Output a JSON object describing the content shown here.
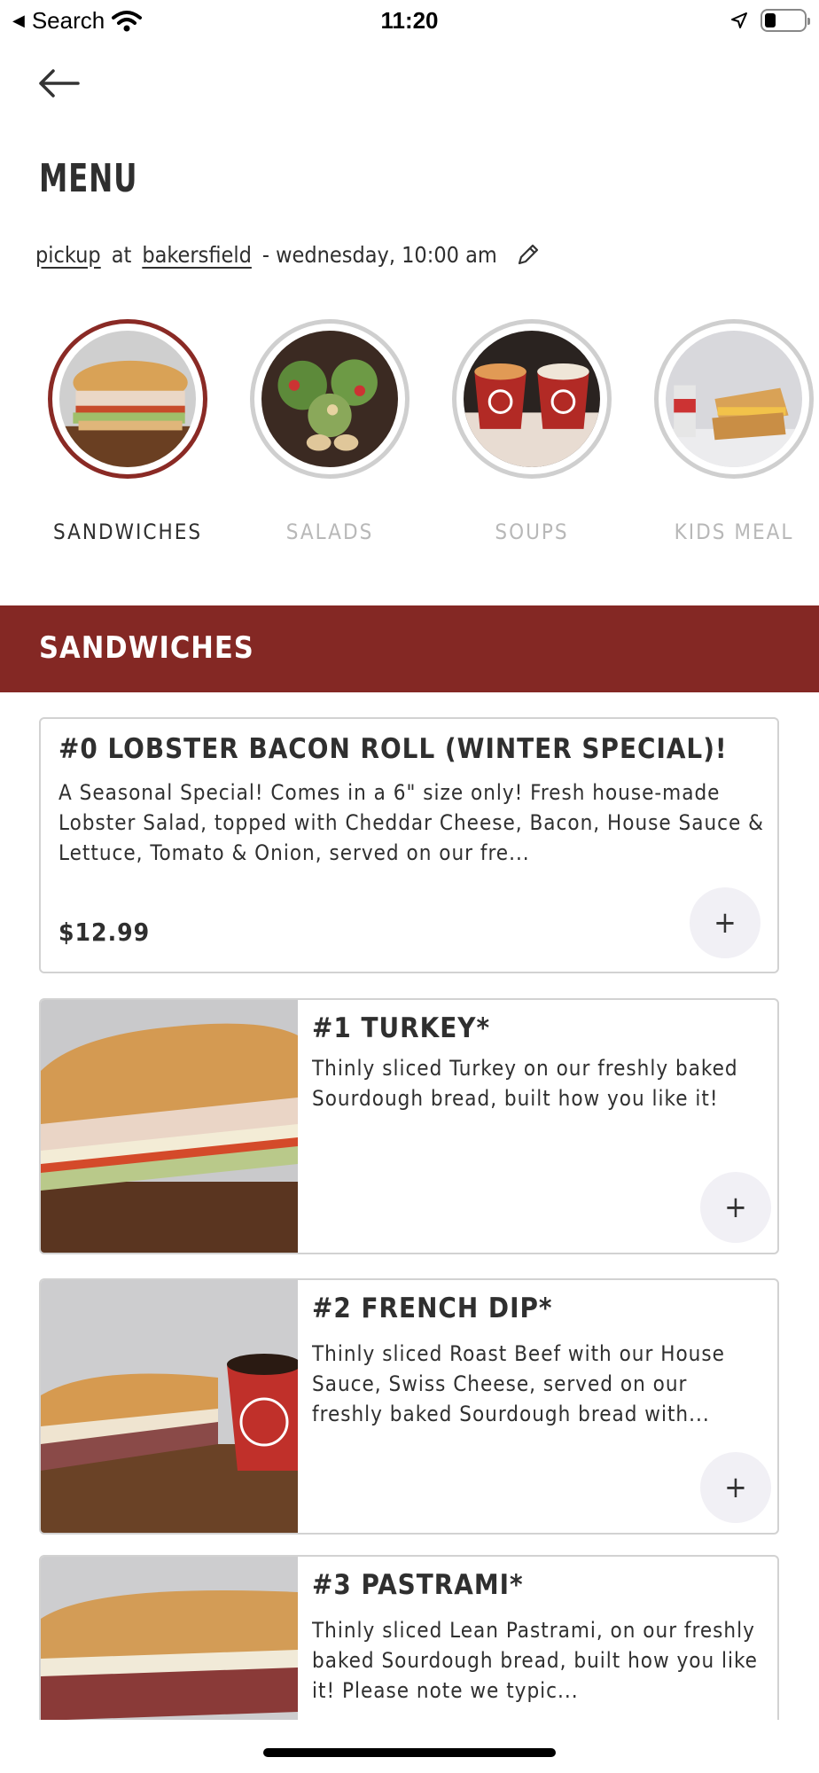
{
  "status_bar": {
    "back_app": "Search",
    "time": "11:20"
  },
  "header": {
    "title": "MENU"
  },
  "order_info": {
    "method": "pickup",
    "at": "at",
    "location": "bakersfield",
    "time": "- wednesday, 10:00 am"
  },
  "categories": [
    {
      "label": "SANDWICHES",
      "active": true
    },
    {
      "label": "SALADS",
      "active": false
    },
    {
      "label": "SOUPS",
      "active": false
    },
    {
      "label": "KIDS MEAL",
      "active": false
    }
  ],
  "section": {
    "title": "SANDWICHES"
  },
  "items": [
    {
      "name": "#0 LOBSTER BACON ROLL (WINTER SPECIAL)!",
      "description": "A Seasonal Special! Comes in a 6\" size only! Fresh house-made Lobster Salad, topped with Cheddar Cheese, Bacon, House Sauce & Lettuce, Tomato & Onion, served on our fre...",
      "price": "$12.99"
    },
    {
      "name": "#1 TURKEY*",
      "description": "Thinly sliced Turkey on our freshly baked Sourdough bread, built how you like it!"
    },
    {
      "name": "#2 FRENCH DIP*",
      "description": "Thinly sliced Roast Beef with our House Sauce, Swiss Cheese, served on our freshly baked Sourdough bread with..."
    },
    {
      "name": "#3 PASTRAMI*",
      "description": "Thinly sliced Lean Pastrami, on our freshly baked Sourdough bread, built how you like it! Please note we typic..."
    }
  ],
  "add_label": "+",
  "colors": {
    "brand": "#842824",
    "add_button_bg": "#f1f0f5"
  }
}
